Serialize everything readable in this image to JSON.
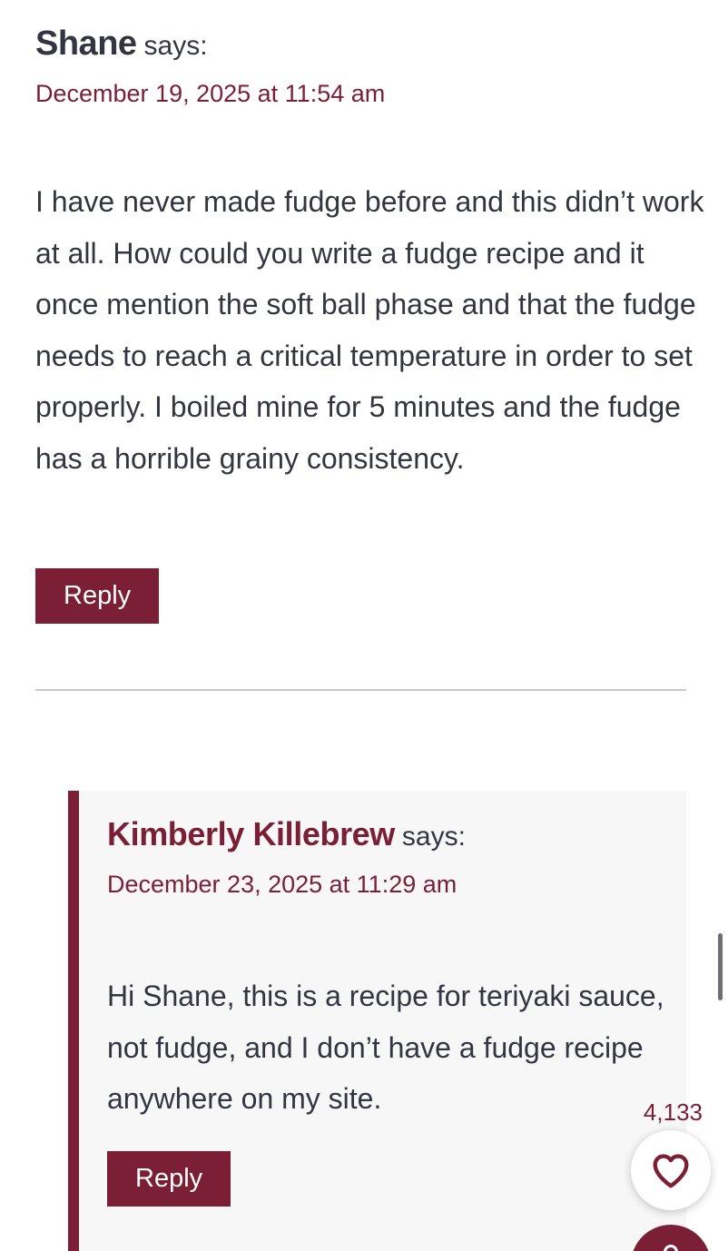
{
  "colors": {
    "accent": "#7a1f36",
    "text": "#333640",
    "reply_background": "#f7f7f8",
    "divider": "#c9cad1"
  },
  "comment": {
    "author": "Shane",
    "says": "says:",
    "date": "December 19, 2025 at 11:54 am",
    "text": "I have never made fudge before and this didn’t work at all. How could you write a fudge recipe and it once mention the soft ball phase and that the fudge needs to reach a critical temperature in order to set properly. I boiled mine for 5 minutes and the fudge has a horrible grainy consistency.",
    "reply_label": "Reply"
  },
  "reply": {
    "author": "Kimberly Killebrew",
    "says": "says:",
    "date": "December 23, 2025 at 11:29 am",
    "text": "Hi Shane, this is a recipe for teriyaki sauce, not fudge, and I don’t have a fudge recipe anywhere on my site.",
    "reply_label": "Reply"
  },
  "floating": {
    "like_count": "4,133",
    "like_icon": "heart-icon",
    "next_icon": "comment-icon"
  }
}
